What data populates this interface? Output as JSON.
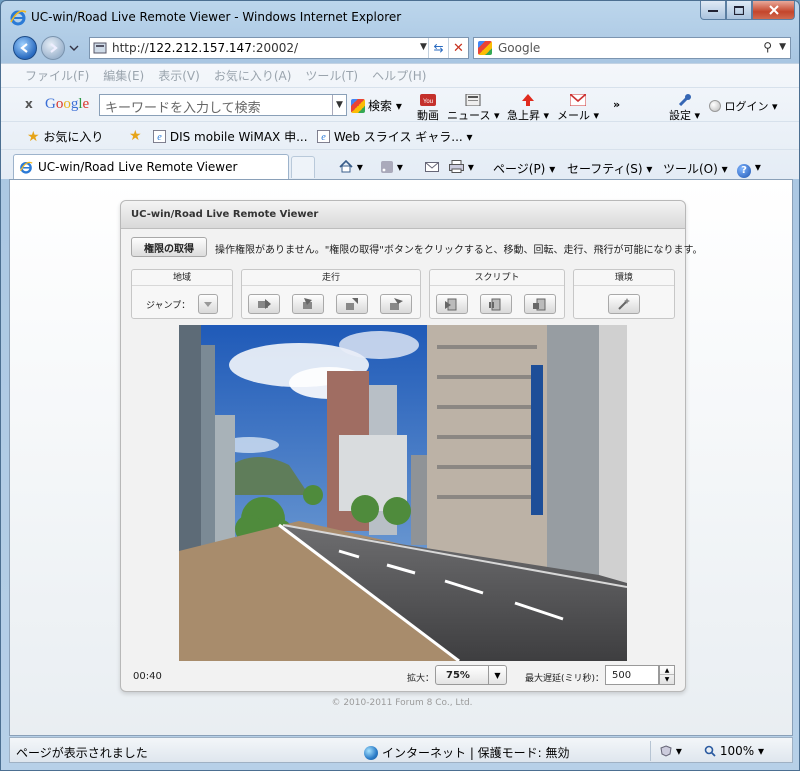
{
  "window": {
    "title": "UC-win/Road Live Remote Viewer - Windows Internet Explorer"
  },
  "address": {
    "url_prefix": "http://",
    "url_host": "122.212.157.147",
    "url_suffix": ":20002/",
    "search_placeholder": "Google"
  },
  "menu": [
    "ファイル(F)",
    "編集(E)",
    "表示(V)",
    "お気に入り(A)",
    "ツール(T)",
    "ヘルプ(H)"
  ],
  "google_toolbar": {
    "close": "x",
    "logo": "Google",
    "placeholder": "キーワードを入力して検索",
    "search": "検索",
    "youtube_label": "動画",
    "news_label": "ニュース",
    "trend_label": "急上昇",
    "mail_label": "メール",
    "more": "»",
    "settings_label": "設定",
    "login_label": "ログイン"
  },
  "favorites": {
    "label": "お気に入り",
    "item1": "DIS mobile WiMAX 申...",
    "item2": "Web スライス ギャラ..."
  },
  "tab": {
    "title": "UC-win/Road Live Remote Viewer"
  },
  "command_bar": {
    "page": "ページ(P)",
    "safety": "セーフティ(S)",
    "tools": "ツール(O)"
  },
  "viewer": {
    "header": "UC-win/Road Live Remote Viewer",
    "auth_button": "権限の取得",
    "auth_message": "操作権限がありません。\"権限の取得\"ボタンをクリックすると、移動、回転、走行、飛行が可能になります。",
    "groups": {
      "map": "地域",
      "drive": "走行",
      "script": "スクリプト",
      "env": "環境"
    },
    "jump_label": "ジャンプ：",
    "time": "00:40",
    "zoom_label": "拡大：",
    "zoom_value": "75%",
    "delay_label": "最大遅延(ミリ秒)：",
    "delay_value": "500",
    "copyright": "© 2010-2011 Forum 8 Co., Ltd."
  },
  "status": {
    "text": "ページが表示されました",
    "zone": "インターネット | 保護モード: 無効",
    "zoom": "100%"
  }
}
